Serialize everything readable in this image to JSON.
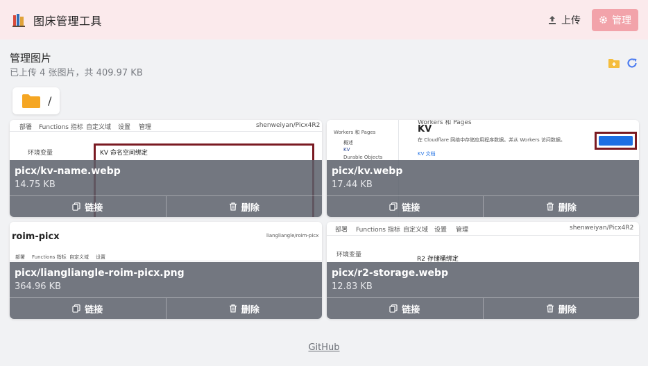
{
  "header": {
    "app_title": "图床管理工具",
    "upload_label": "上传",
    "manage_label": "管理",
    "colors": {
      "bar": "#fbeaec",
      "manage_btn": "#f2a3aa"
    }
  },
  "section": {
    "title": "管理图片",
    "subtitle": "已上传 4 张图片，共 409.97 KB"
  },
  "folder": {
    "path": "/"
  },
  "images": [
    {
      "name": "picx/kv-name.webp",
      "size": "14.75 KB",
      "link_label": "链接",
      "delete_label": "删除",
      "thumb": {
        "tabs": [
          "部署",
          "Functions 指标",
          "自定义域",
          "设置",
          "管理"
        ],
        "owner": "shenweiyan/Picx4R2",
        "left_label": "环境变量",
        "box_label": "KV 命名空间绑定"
      }
    },
    {
      "name": "picx/kv.webp",
      "size": "17.44 KB",
      "link_label": "链接",
      "delete_label": "删除",
      "thumb": {
        "header": "Workers 和 Pages",
        "title": "KV",
        "desc": "在 Cloudflare 网络中存储应用程序数据。并从 Workers 访问数据。",
        "nav": [
          "Workers 和 Pages",
          "概述",
          "KV",
          "Durable Objects"
        ],
        "docs": "KV 文档"
      }
    },
    {
      "name": "picx/liangliangle-roim-picx.png",
      "size": "364.96 KB",
      "link_label": "链接",
      "delete_label": "删除",
      "thumb": {
        "title": "roim-picx",
        "owner": "liangliangle/roim-picx",
        "tabs": [
          "部署",
          "Functions 指标",
          "自定义域",
          "设置"
        ]
      }
    },
    {
      "name": "picx/r2-storage.webp",
      "size": "12.83 KB",
      "link_label": "链接",
      "delete_label": "删除",
      "thumb": {
        "tabs": [
          "部署",
          "Functions 指标",
          "自定义域",
          "设置",
          "管理"
        ],
        "owner": "shenweiyan/Picx4R2",
        "left_label": "环境变量",
        "box_label": "R2 存储桶绑定"
      }
    }
  ],
  "footer": {
    "link": "GitHub"
  }
}
